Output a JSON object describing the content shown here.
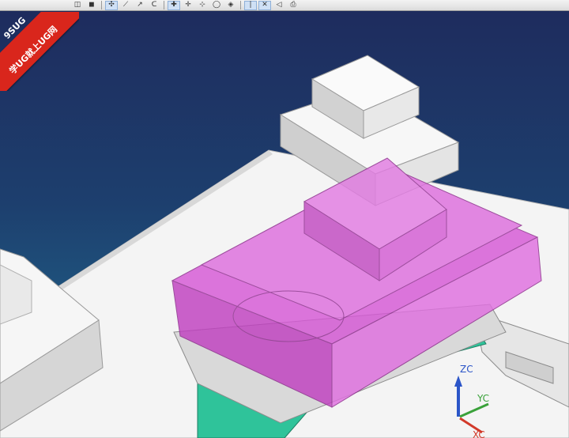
{
  "toolbar": {
    "buttons": [
      {
        "icon": "wireframe-icon",
        "glyph": "◫",
        "active": false
      },
      {
        "icon": "cube-icon",
        "glyph": "◼",
        "active": false
      },
      {
        "icon": "snap-point-icon",
        "glyph": "✣",
        "active": true
      },
      {
        "icon": "line-icon",
        "glyph": "⟋",
        "active": false
      },
      {
        "icon": "arc-icon",
        "glyph": "↗",
        "active": false
      },
      {
        "icon": "curve-icon",
        "glyph": "ᑕ",
        "active": false
      },
      {
        "icon": "endpoint-icon",
        "glyph": "✚",
        "active": true
      },
      {
        "icon": "midpoint-icon",
        "glyph": "✛",
        "active": false
      },
      {
        "icon": "center-icon",
        "glyph": "⊹",
        "active": false
      },
      {
        "icon": "circle-center-icon",
        "glyph": "◯",
        "active": false
      },
      {
        "icon": "quadrant-icon",
        "glyph": "◈",
        "active": false
      },
      {
        "icon": "on-curve-icon",
        "glyph": "|",
        "active": true
      },
      {
        "icon": "intersection-icon",
        "glyph": "✕",
        "active": true
      },
      {
        "icon": "view-icon",
        "glyph": "◁",
        "active": false
      },
      {
        "icon": "print-icon",
        "glyph": "⎙",
        "active": false
      }
    ]
  },
  "watermark": {
    "title": "9SUG",
    "subtitle": "学UG就上UG网",
    "color": "#d9261c"
  },
  "triad": {
    "zc_label": "ZC",
    "yc_label": "YC",
    "xc_label": "XC",
    "zc_color": "#2b55c8",
    "yc_color": "#3aa13a",
    "xc_color": "#d23a2a"
  },
  "colors": {
    "background_top": "#1e2c5e",
    "background_bottom": "#2a6d92",
    "mold_base": "#f2f2f2",
    "insert_magenta": "#d658d6",
    "slider_green": "#2fc39a"
  }
}
